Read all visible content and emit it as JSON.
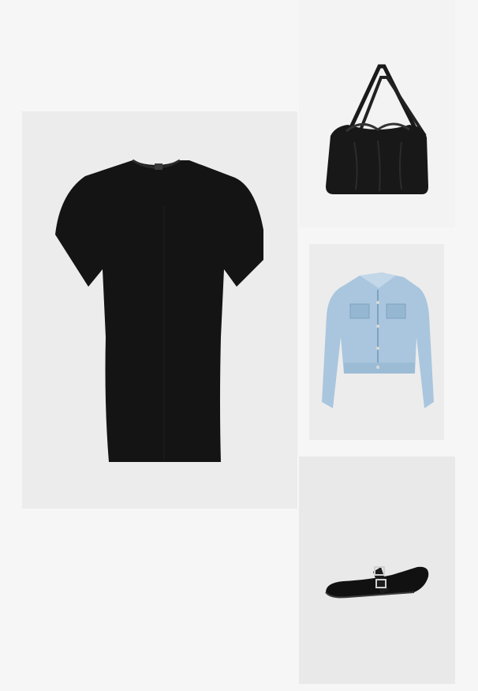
{
  "outfit": {
    "items": [
      {
        "name": "dress",
        "kind": "black t-shirt dress",
        "main_color": "#141414"
      },
      {
        "name": "bag",
        "kind": "black drawstring tote bag",
        "main_color": "#181818"
      },
      {
        "name": "jacket",
        "kind": "light blue cropped denim jacket",
        "main_color": "#a9c6de"
      },
      {
        "name": "shoe",
        "kind": "black ballet flat with buckle strap",
        "main_color": "#111111"
      }
    ]
  },
  "colors": {
    "page_background": "#f6f6f6",
    "tile_background": "#ececec"
  }
}
